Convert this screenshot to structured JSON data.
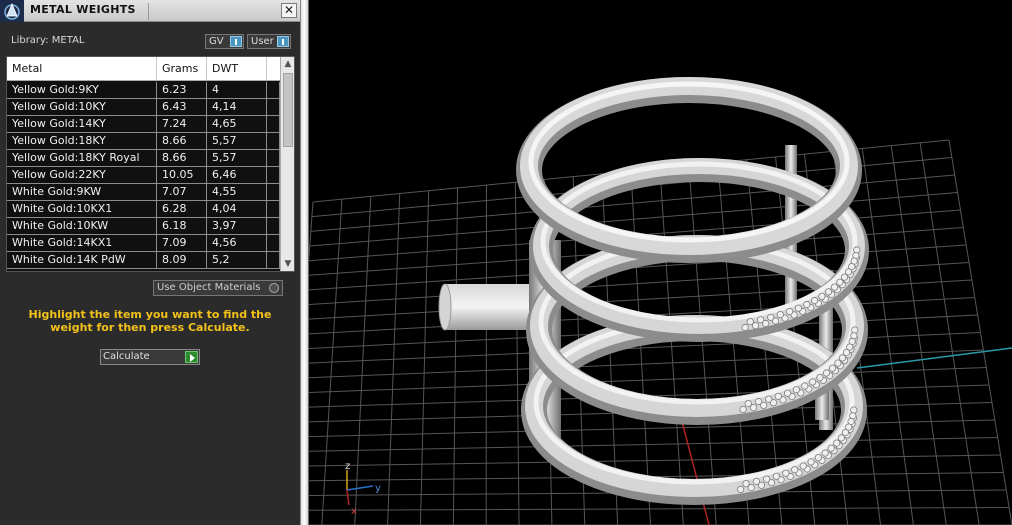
{
  "panel": {
    "title": "METAL WEIGHTS",
    "close_glyph": "✕",
    "library_label": "Library: METAL",
    "toggles": {
      "gv": "GV",
      "user": "User"
    },
    "columns": {
      "metal": "Metal",
      "grams": "Grams",
      "dwt": "DWT"
    },
    "rows": [
      {
        "metal": "Yellow Gold:9KY",
        "grams": "6.23",
        "dwt": "4"
      },
      {
        "metal": "Yellow Gold:10KY",
        "grams": "6.43",
        "dwt": "4,14"
      },
      {
        "metal": "Yellow Gold:14KY",
        "grams": "7.24",
        "dwt": "4,65"
      },
      {
        "metal": "Yellow Gold:18KY",
        "grams": "8.66",
        "dwt": "5,57"
      },
      {
        "metal": "Yellow Gold:18KY Royal",
        "grams": "8.66",
        "dwt": "5,57"
      },
      {
        "metal": "Yellow Gold:22KY",
        "grams": "10.05",
        "dwt": "6,46"
      },
      {
        "metal": "White Gold:9KW",
        "grams": "7.07",
        "dwt": "4,55"
      },
      {
        "metal": "White Gold:10KX1",
        "grams": "6.28",
        "dwt": "4,04"
      },
      {
        "metal": "White Gold:10KW",
        "grams": "6.18",
        "dwt": "3,97"
      },
      {
        "metal": "White Gold:14KX1",
        "grams": "7.09",
        "dwt": "4,56"
      },
      {
        "metal": "White Gold:14K PdW",
        "grams": "8.09",
        "dwt": "5,2"
      }
    ],
    "use_object_materials": "Use Object Materials",
    "instruction": "Highlight the item you want to find the weight for then press Calculate.",
    "calculate_label": "Calculate"
  },
  "viewport": {
    "axis_labels": {
      "z": "z",
      "y": "y",
      "x": "x"
    }
  },
  "colors": {
    "panel_bg": "#2b2b2b",
    "instruction_text": "#f2c21b",
    "ring_metal": "#c8c8c8",
    "grid": "#5a5a5a"
  }
}
